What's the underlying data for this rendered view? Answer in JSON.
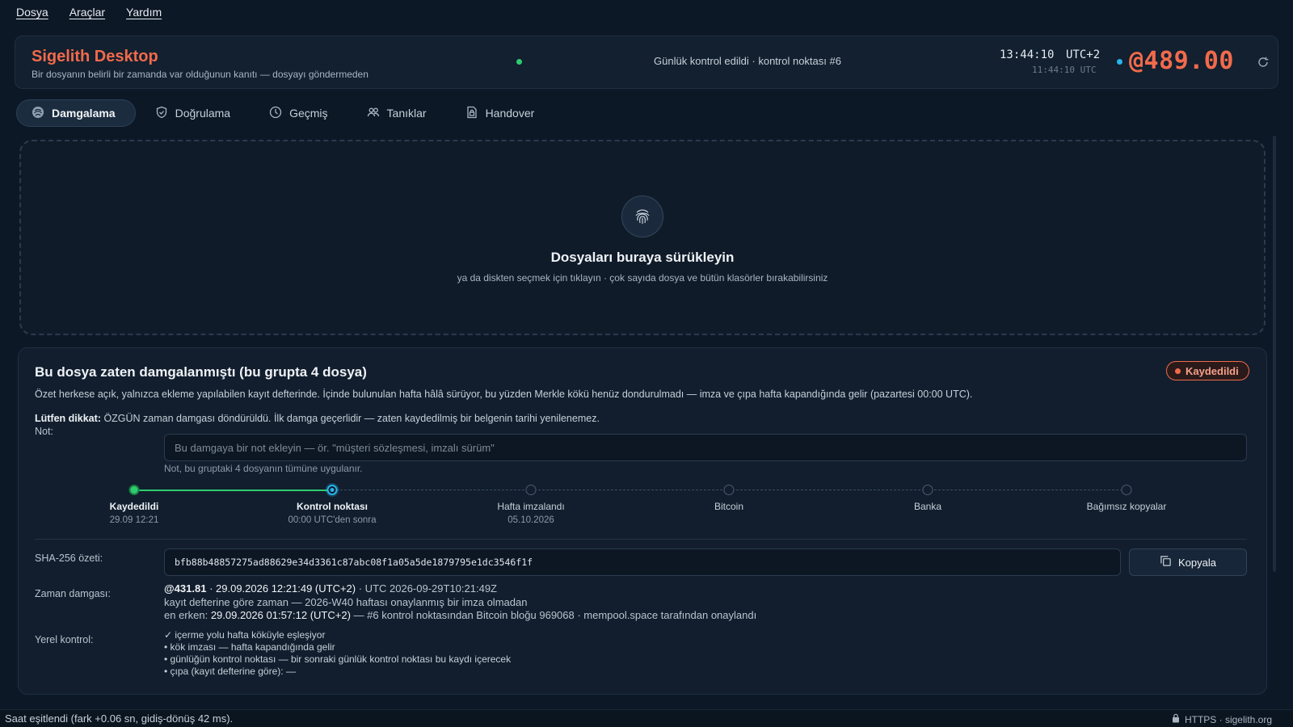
{
  "menu": [
    "Dosya",
    "Araçlar",
    "Yardım"
  ],
  "header": {
    "title": "Sigelith Desktop",
    "subtitle": "Bir dosyanın belirli bir zamanda var olduğunun kanıtı — dosyayı göndermeden",
    "daily_status": "Günlük kontrol edildi · kontrol noktası #6",
    "local_time": "13:44:10",
    "timezone": "UTC+2",
    "utc_time": "11:44:10 UTC",
    "balance": "@489.00"
  },
  "tabs": [
    {
      "label": "Damgalama",
      "icon": "stamp-icon",
      "active": true
    },
    {
      "label": "Doğrulama",
      "icon": "shield-check-icon",
      "active": false
    },
    {
      "label": "Geçmiş",
      "icon": "clock-icon",
      "active": false
    },
    {
      "label": "Tanıklar",
      "icon": "users-icon",
      "active": false
    },
    {
      "label": "Handover",
      "icon": "document-lock-icon",
      "active": false
    }
  ],
  "dropzone": {
    "title": "Dosyaları buraya sürükleyin",
    "subtitle": "ya da diskten seçmek için tıklayın · çok sayıda dosya ve bütün klasörler bırakabilirsiniz",
    "icon": "fingerprint-icon"
  },
  "result": {
    "title": "Bu dosya zaten damgalanmıştı (bu grupta 4 dosya)",
    "badge": "Kaydedildi",
    "summary": "Özet herkese açık, yalnızca ekleme yapılabilen kayıt defterinde. İçinde bulunulan hafta hâlâ sürüyor, bu yüzden Merkle kökü henüz dondurulmadı — imza ve çıpa hafta kapandığında gelir (pazartesi 00:00 UTC).",
    "warning_label": "Lütfen dikkat:",
    "warning_text": "ÖZGÜN zaman damgası döndürüldü. İlk damga geçerlidir — zaten kaydedilmiş bir belgenin tarihi yenilenemez.",
    "note_label": "Not:",
    "note_placeholder": "Bu damgaya bir not ekleyin — ör. \"müşteri sözleşmesi, imzalı sürüm\"",
    "note_help": "Not, bu gruptaki 4 dosyanın tümüne uygulanır.",
    "timeline": [
      {
        "label": "Kaydedildi",
        "sub": "29.09 12:21",
        "state": "done"
      },
      {
        "label": "Kontrol noktası",
        "sub": "00:00 UTC'den sonra",
        "state": "current"
      },
      {
        "label": "Hafta imzalandı",
        "sub": "05.10.2026",
        "state": "pending"
      },
      {
        "label": "Bitcoin",
        "sub": "",
        "state": "pending"
      },
      {
        "label": "Banka",
        "sub": "",
        "state": "pending"
      },
      {
        "label": "Bağımsız kopyalar",
        "sub": "",
        "state": "pending"
      }
    ],
    "hash_label": "SHA-256 özeti:",
    "hash": "bfb88b48857275ad88629e34d3361c87abc08f1a05a5de1879795e1dc3546f1f",
    "copy_label": "Kopyala",
    "timestamp_label": "Zaman damgası:",
    "ts_value": "@431.81",
    "ts_local": "· 29.09.2026 12:21:49 (UTC+2)",
    "ts_utc": "· UTC 2026-09-29T10:21:49Z",
    "ts_line2": "kayıt defterine göre zaman — 2026-W40 haftası onaylanmış bir imza olmadan",
    "ts_line3_prefix": "en erken:",
    "ts_line3_time": "29.09.2026 01:57:12 (UTC+2)",
    "ts_line3_rest": "— #6 kontrol noktasından Bitcoin bloğu 969068 · mempool.space tarafından onaylandı",
    "local_check_label": "Yerel kontrol:",
    "checks": [
      "✓ içerme yolu hafta köküyle eşleşiyor",
      "• kök imzası — hafta kapandığında gelir",
      "• günlüğün kontrol noktası — bir sonraki günlük kontrol noktası bu kaydı içerecek",
      "• çıpa (kayıt defterine göre): —"
    ]
  },
  "status": {
    "left": "Saat eşitlendi (fark +0.06 sn, gidiş-dönüş 42 ms).",
    "right": "HTTPS · sigelith.org"
  },
  "colors": {
    "accent": "#f26a4b",
    "success": "#2ecc71",
    "info": "#27b5ea",
    "background": "#0d1826"
  }
}
